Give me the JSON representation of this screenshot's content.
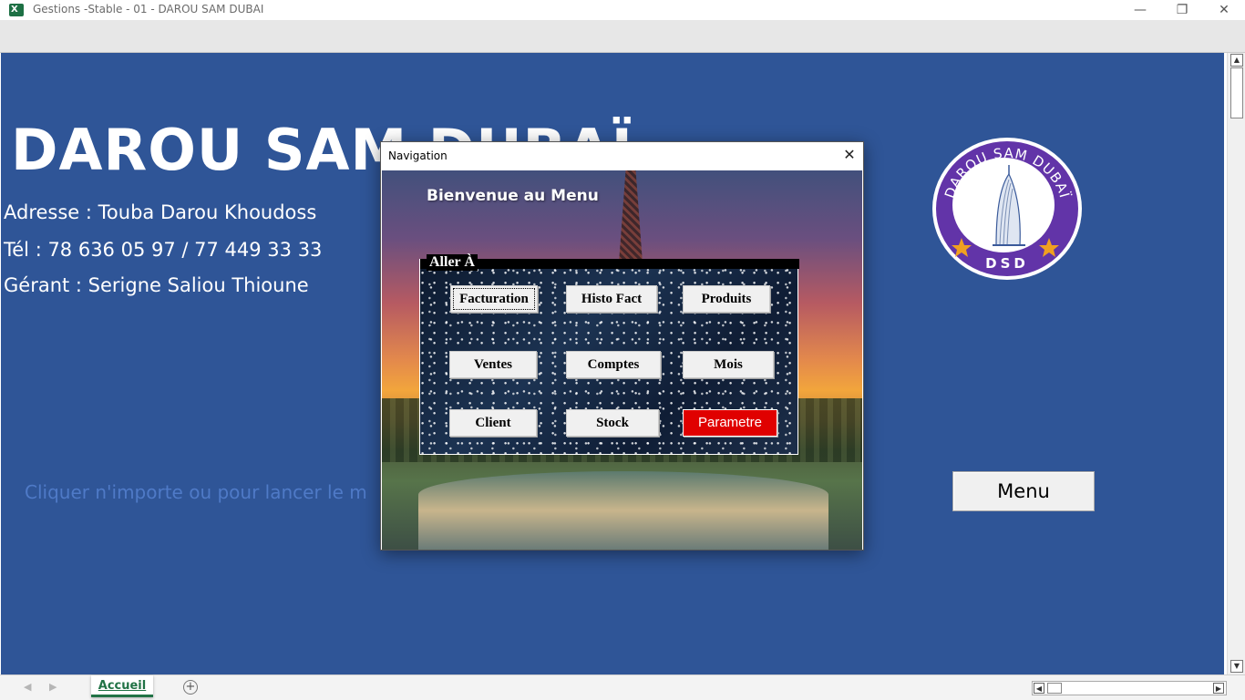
{
  "window": {
    "title": "Gestions -Stable - 01 - DAROU SAM DUBAI",
    "controls": {
      "minimize": "—",
      "restore": "❐",
      "close": "✕"
    }
  },
  "sheet": {
    "company_name": "DAROU SAM DUBAÏ",
    "address": "Adresse : Touba Darou Khoudoss",
    "phone": "Tél : 78 636 05 97 / 77 449 33 33",
    "manager": "Gérant : Serigne Saliou Thioune",
    "hint": "Cliquer n'importe ou pour lancer le m",
    "menu_button": "Menu",
    "logo": {
      "top_text": "DAROU SAM DUBAÏ",
      "bottom_text": "DSD",
      "icon": "burj-al-arab-icon",
      "ring_color": "#6234a8",
      "star_color": "#f0a020"
    },
    "background_color": "#2f5597"
  },
  "dialog": {
    "title": "Navigation",
    "close_label": "✕",
    "welcome": "Bienvenue au Menu",
    "frame_label": "Aller À",
    "buttons": [
      {
        "label": "Facturation"
      },
      {
        "label": "Histo Fact"
      },
      {
        "label": "Produits"
      },
      {
        "label": "Ventes"
      },
      {
        "label": "Comptes"
      },
      {
        "label": "Mois"
      },
      {
        "label": "Client"
      },
      {
        "label": "Stock"
      },
      {
        "label": "Parametre"
      }
    ],
    "danger_color": "#e00000"
  },
  "tabs": {
    "active": "Accueil",
    "add_label": "+"
  }
}
